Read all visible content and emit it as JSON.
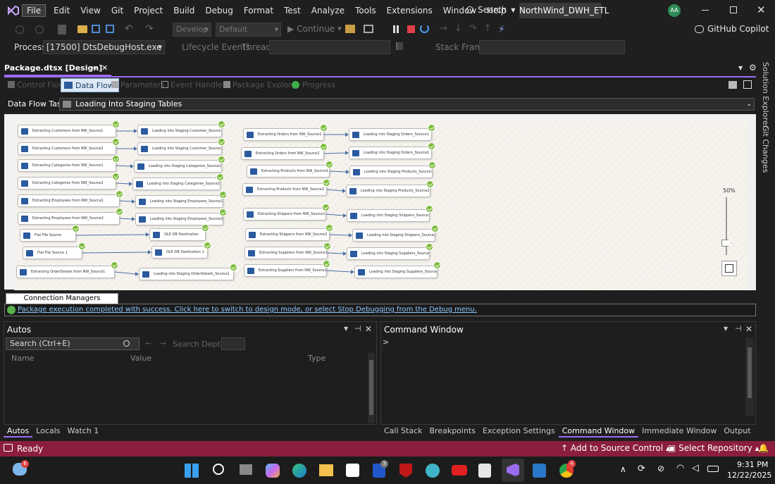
{
  "titlebar": {
    "menu": [
      "File",
      "Edit",
      "View",
      "Git",
      "Project",
      "Build",
      "Debug",
      "Format",
      "Test",
      "Analyze",
      "Tools",
      "Extensions",
      "Window",
      "Help"
    ],
    "search_label": "Search",
    "solution_name": "NorthWind_DWH_ETL",
    "avatar": "AA"
  },
  "toolbar": {
    "develop": "Develop",
    "default": "Default",
    "continue": "Continue",
    "copilot": "GitHub Copilot"
  },
  "debugbar": {
    "process_label": "Process:",
    "process_value": "[17500] DtsDebugHost.exe",
    "lifecycle": "Lifecycle Events",
    "thread": "Thread:",
    "stack_frame": "Stack Frame:"
  },
  "doc": {
    "tab_title": "Package.dtsx [Design]",
    "designer_tabs": [
      "Control Flow",
      "Data Flow",
      "Parameters",
      "Event Handlers",
      "Package Explorer",
      "Progress"
    ],
    "active_tab": "Data Flow",
    "dft_label": "Data Flow Task:",
    "dft_value": "Loading Into Staging Tables",
    "zoom": "50%",
    "connection_managers": "Connection Managers",
    "status_message": "Package execution completed with success. Click here to switch to design mode, or select Stop Debugging from the Debug menu."
  },
  "flow_left": [
    {
      "src": "Extracting Customers from NW_Source1",
      "dst": "Loading into Staging Customer_Source1"
    },
    {
      "src": "Extracting Customers from NW_Source2",
      "dst": "Loading into Staging Customer_Source2"
    },
    {
      "src": "Extracting Categories from NW_Source1",
      "dst": "Loading into Staging Categories_Source1"
    },
    {
      "src": "Extracting Categories from NW_Source2",
      "dst": "Loading into Staging Categories_Source2"
    },
    {
      "src": "Extracting Employees from NW_Source1",
      "dst": "Loading into Staging Employees_Source1"
    },
    {
      "src": "Extracting Employees from NW_Source2",
      "dst": "Loading into Staging Employees_Source2"
    },
    {
      "src": "Flat File Source",
      "dst": "OLE DB Destination"
    },
    {
      "src": "Flat File Source 1",
      "dst": "OLE DB Destination 1"
    },
    {
      "src": "Extracting OrderDetails from NW_Source1",
      "dst": "Loading into Staging OrderDetails_Source1"
    }
  ],
  "flow_right": [
    {
      "src": "Extracting Orders from NW_Source1",
      "dst": "Loading into Staging Orders_Source1"
    },
    {
      "src": "Extracting Orders from NW_Source2",
      "dst": "Loading into Staging Orders_Source2"
    },
    {
      "src": "Extracting Products from NW_Source1",
      "dst": "Loading into Staging Products_Source1"
    },
    {
      "src": "Extracting Products from NW_Source2",
      "dst": "Loading into Staging Products_Source2"
    },
    {
      "src": "Extracting Shippers from NW_Source1",
      "dst": "Loading into Staging Shippers_Source1"
    },
    {
      "src": "Extracting Shippers from NW_Source2",
      "dst": "Loading into Staging Shippers_Source2"
    },
    {
      "src": "Extracting Suppliers from NW_Source1",
      "dst": "Loading into Staging Suppliers_Source1"
    },
    {
      "src": "Extracting Suppliers from NW_Source2",
      "dst": "Loading into Staging Suppliers_Source2"
    }
  ],
  "autos": {
    "title": "Autos",
    "search_placeholder": "Search (Ctrl+E)",
    "search_depth": "Search Depth:",
    "columns": [
      "Name",
      "Value",
      "Type"
    ],
    "tabs": [
      "Autos",
      "Locals",
      "Watch 1"
    ]
  },
  "command": {
    "title": "Command Window",
    "prompt": ">",
    "tabs": [
      "Call Stack",
      "Breakpoints",
      "Exception Settings",
      "Command Window",
      "Immediate Window",
      "Output"
    ]
  },
  "side": {
    "solution_explorer": "Solution Explorer",
    "git_changes": "Git Changes"
  },
  "statusbar": {
    "ready": "Ready",
    "source_control": "Add to Source Control",
    "repo": "Select Repository"
  },
  "taskbar": {
    "time": "9:31 PM",
    "date": "12/22/2025",
    "badge1": "6",
    "badge2": "3",
    "badge3": "4"
  }
}
